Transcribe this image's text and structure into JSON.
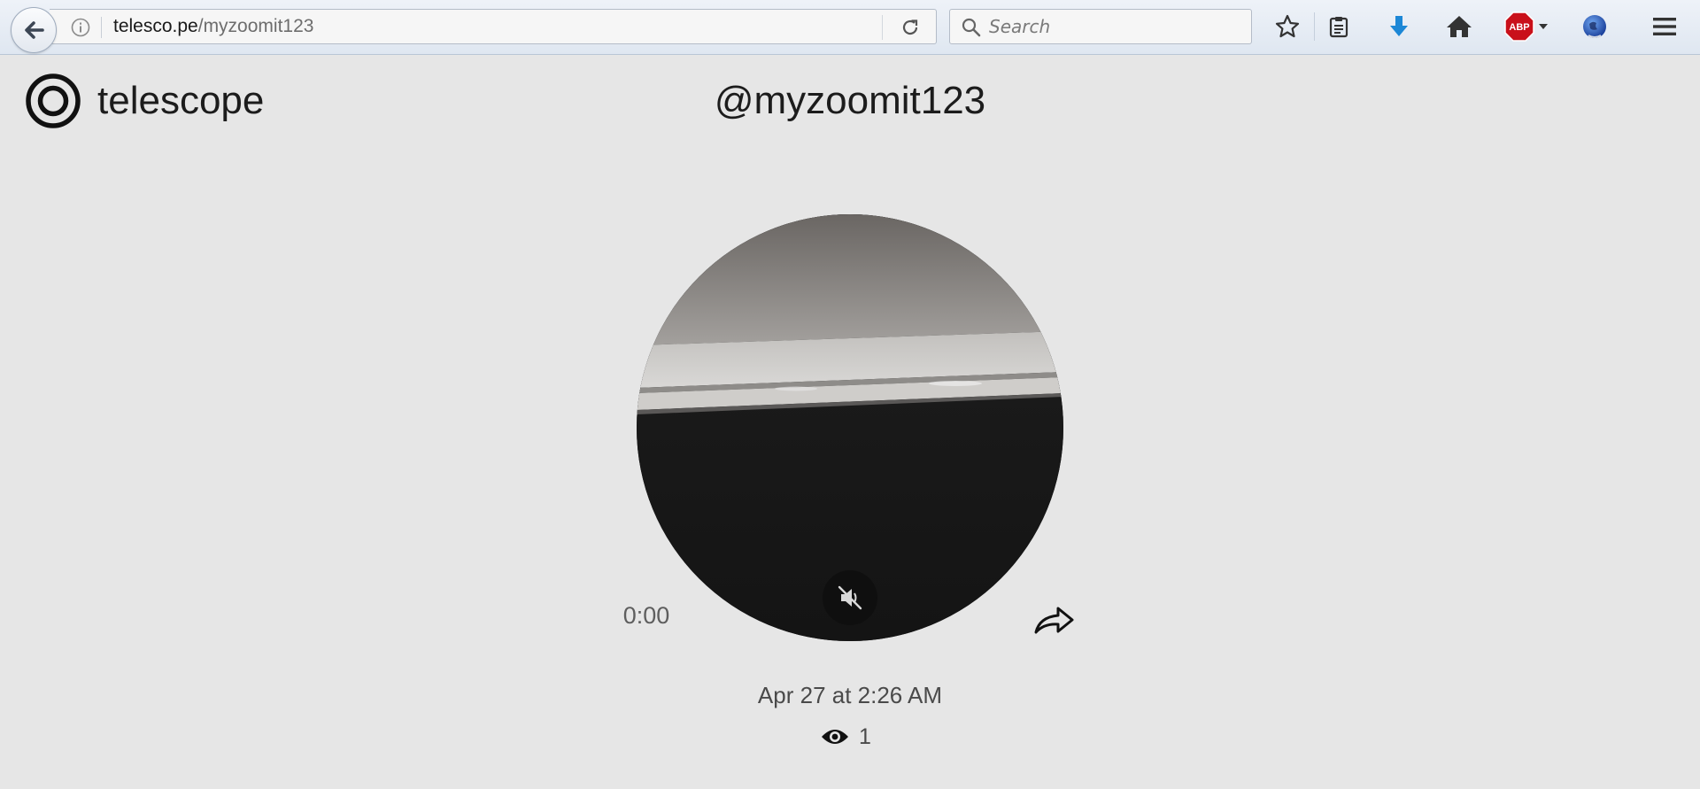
{
  "browser": {
    "url_host": "telesco.pe",
    "url_path": "/myzoomit123",
    "search_placeholder": "Search",
    "adblock_label": "ABP"
  },
  "page": {
    "site_name": "telescope",
    "username": "@myzoomit123",
    "playback_time": "0:00",
    "posted_date": "Apr 27 at 2:26 AM",
    "view_count": "1"
  },
  "icons": {
    "back": "arrow-left-icon",
    "info": "info-icon",
    "reload": "reload-icon",
    "search": "search-icon",
    "bookmark": "star-icon",
    "reading_list": "clipboard-icon",
    "download": "download-arrow-icon",
    "home": "home-icon",
    "adblock": "adblock-plus-icon",
    "addon": "globe-icon",
    "menu": "hamburger-icon",
    "logo": "telescope-logo-icon",
    "mute": "speaker-muted-icon",
    "share": "share-arrow-icon",
    "views": "eye-icon"
  },
  "colors": {
    "page_background": "#e6e6e6",
    "download_arrow": "#1c87d6",
    "adblock_red": "#c9101a"
  }
}
